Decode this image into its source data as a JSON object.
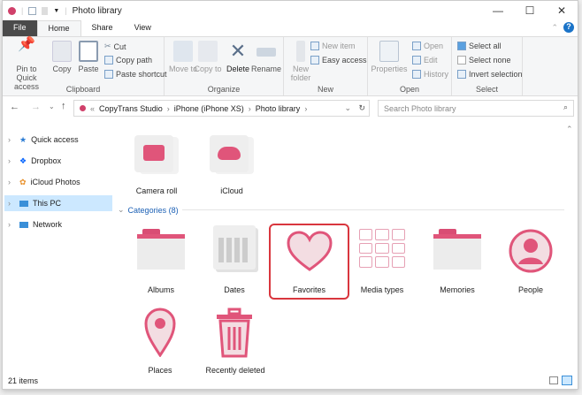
{
  "window": {
    "title": "Photo library",
    "minimize": "—",
    "maximize": "☐",
    "close": "✕",
    "help": "?"
  },
  "tabs": [
    "File",
    "Home",
    "Share",
    "View"
  ],
  "ribbon": {
    "clipboard": {
      "label": "Clipboard",
      "pin": "Pin to Quick access",
      "copy": "Copy",
      "paste": "Paste",
      "cut": "Cut",
      "copy_path": "Copy path",
      "paste_shortcut": "Paste shortcut"
    },
    "organize": {
      "label": "Organize",
      "move_to": "Move to",
      "copy_to": "Copy to",
      "delete": "Delete",
      "rename": "Rename"
    },
    "new": {
      "label": "New",
      "new_folder": "New folder",
      "new_item": "New item",
      "easy_access": "Easy access"
    },
    "open": {
      "label": "Open",
      "properties": "Properties",
      "open": "Open",
      "edit": "Edit",
      "history": "History"
    },
    "select": {
      "label": "Select",
      "select_all": "Select all",
      "select_none": "Select none",
      "invert": "Invert selection"
    }
  },
  "address": {
    "prefix": "«",
    "crumbs": [
      "CopyTrans Studio",
      "iPhone (iPhone XS)",
      "Photo library"
    ],
    "search_placeholder": "Search Photo library"
  },
  "nav": [
    "Quick access",
    "Dropbox",
    "iCloud Photos",
    "This PC",
    "Network"
  ],
  "top_items": [
    "Camera roll",
    "iCloud"
  ],
  "categories_header": "Categories (8)",
  "categories": [
    "Albums",
    "Dates",
    "Favorites",
    "Media types",
    "Memories",
    "People",
    "Places",
    "Recently deleted"
  ],
  "status": {
    "count": "21 items"
  },
  "colors": {
    "accent": "#e0557a",
    "select_border": "#d9363e"
  }
}
